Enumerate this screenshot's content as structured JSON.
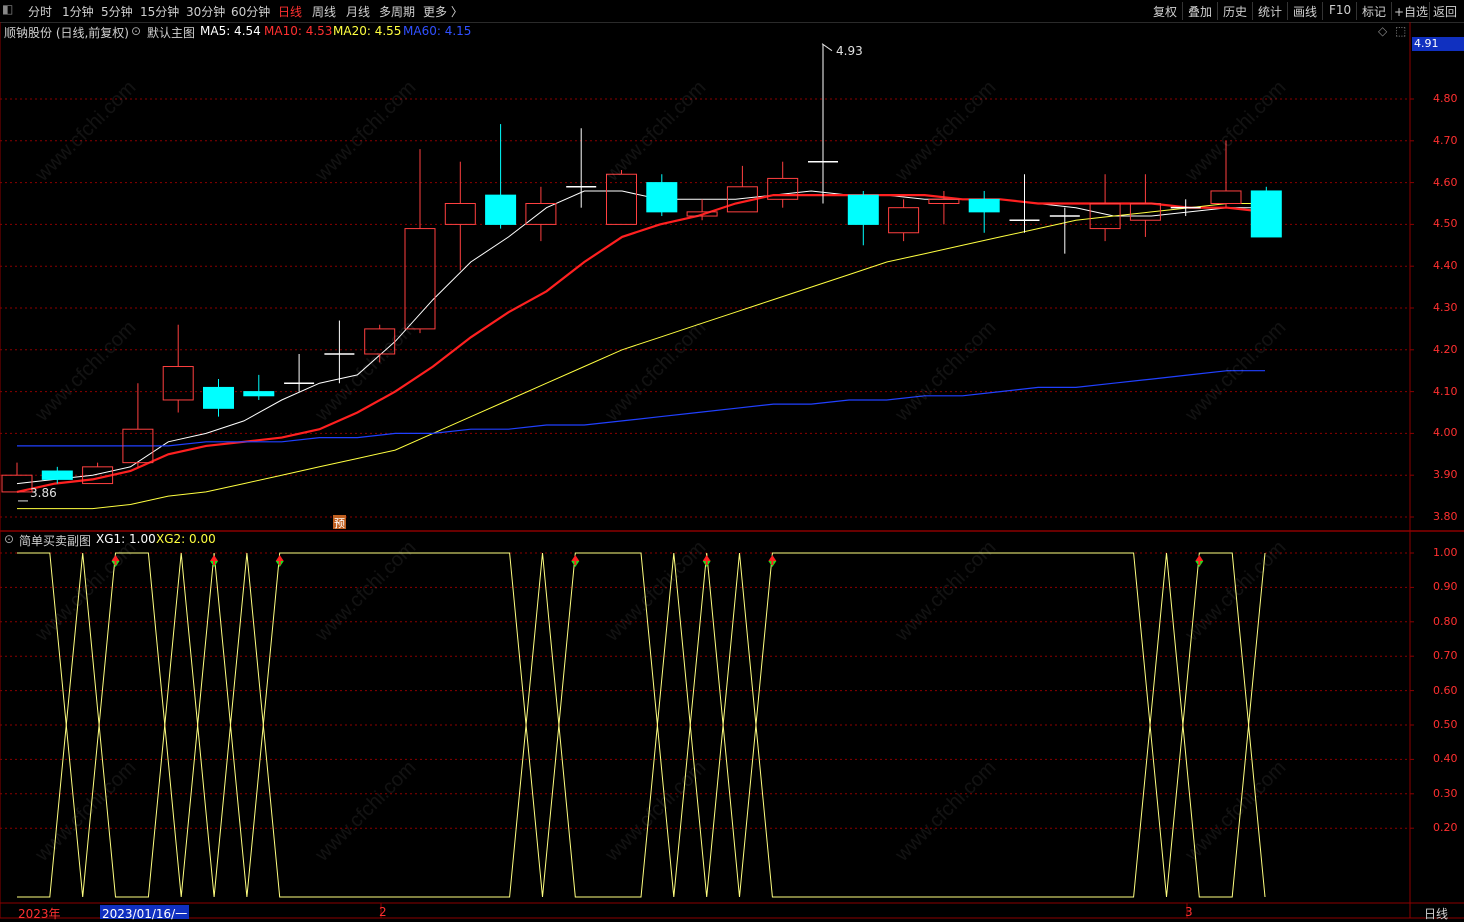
{
  "toolbar": {
    "periods": [
      "分时",
      "1分钟",
      "5分钟",
      "15分钟",
      "30分钟",
      "60分钟",
      "日线",
      "周线",
      "月线",
      "多周期",
      "更多 〉"
    ],
    "active_period": "日线",
    "right_buttons": [
      "复权",
      "叠加",
      "历史",
      "统计",
      "画线",
      "F10",
      "标记",
      "+自选",
      "返回"
    ]
  },
  "main_header": {
    "stock_name": "顺钠股份 (日线,前复权)",
    "chart_name": "默认主图",
    "ma5_label": "MA5: 4.54",
    "ma10_label": "MA10: 4.53",
    "ma20_label": "MA20: 4.55",
    "ma60_label": "MA60: 4.15",
    "current_price_tag": "4.91",
    "high_label": "4.93",
    "low_label": "3.86",
    "marker": "预"
  },
  "sub_header": {
    "indicator_name": "简单买卖副图",
    "xg1_label": "XG1: 1.00",
    "xg2_label": "XG2: 0.00"
  },
  "price_axis": [
    "4.80",
    "4.70",
    "4.60",
    "4.50",
    "4.40",
    "4.30",
    "4.20",
    "4.10",
    "4.00",
    "3.90",
    "3.80"
  ],
  "sub_axis": [
    "1.00",
    "0.90",
    "0.80",
    "0.70",
    "0.60",
    "0.50",
    "0.40",
    "0.30",
    "0.20"
  ],
  "date_axis": {
    "year": "2023年",
    "cursor_date": "2023/01/16/一",
    "month_2": "2",
    "month_3": "3",
    "period_label": "日线"
  },
  "watermark": "www.cfchi.com",
  "colors": {
    "up": "#ff4040",
    "down": "#00ffff",
    "ma5": "#ffffff",
    "ma10": "#ff2020",
    "ma20": "#ffff40",
    "ma60": "#2040ff",
    "signal": "#ffff80",
    "grid": "#8b0000"
  },
  "chart_data": [
    {
      "type": "candlestick",
      "series": [
        {
          "name": "MA5",
          "values": [
            3.88,
            3.89,
            3.9,
            3.92,
            3.98,
            4.0,
            4.03,
            4.08,
            4.12,
            4.14,
            4.22,
            4.32,
            4.41,
            4.47,
            4.54,
            4.58,
            4.58,
            4.56,
            4.56,
            4.56,
            4.57,
            4.58,
            4.57,
            4.57,
            4.56,
            4.56,
            4.56,
            4.55,
            4.54,
            4.52,
            4.52,
            4.53,
            4.54,
            4.54
          ]
        },
        {
          "name": "MA10",
          "values": [
            3.86,
            3.88,
            3.89,
            3.91,
            3.95,
            3.97,
            3.98,
            3.99,
            4.01,
            4.05,
            4.1,
            4.16,
            4.23,
            4.29,
            4.34,
            4.41,
            4.47,
            4.5,
            4.52,
            4.55,
            4.57,
            4.57,
            4.57,
            4.57,
            4.57,
            4.56,
            4.56,
            4.55,
            4.55,
            4.55,
            4.55,
            4.54,
            4.54,
            4.53
          ]
        },
        {
          "name": "MA20",
          "values": [
            3.82,
            3.82,
            3.82,
            3.83,
            3.85,
            3.86,
            3.88,
            3.9,
            3.92,
            3.94,
            3.96,
            4.0,
            4.04,
            4.08,
            4.12,
            4.16,
            4.2,
            4.23,
            4.26,
            4.29,
            4.32,
            4.35,
            4.38,
            4.41,
            4.43,
            4.45,
            4.47,
            4.49,
            4.51,
            4.52,
            4.53,
            4.54,
            4.55,
            4.55
          ]
        },
        {
          "name": "MA60",
          "values": [
            3.97,
            3.97,
            3.97,
            3.97,
            3.97,
            3.98,
            3.98,
            3.98,
            3.99,
            3.99,
            4.0,
            4.0,
            4.01,
            4.01,
            4.02,
            4.02,
            4.03,
            4.04,
            4.05,
            4.06,
            4.07,
            4.07,
            4.08,
            4.08,
            4.09,
            4.09,
            4.1,
            4.11,
            4.11,
            4.12,
            4.13,
            4.14,
            4.15,
            4.15
          ]
        }
      ],
      "candles": [
        {
          "o": 3.86,
          "c": 3.9,
          "h": 3.93,
          "l": 3.86
        },
        {
          "o": 3.91,
          "c": 3.89,
          "h": 3.92,
          "l": 3.88
        },
        {
          "o": 3.88,
          "c": 3.92,
          "h": 3.93,
          "l": 3.88
        },
        {
          "o": 3.93,
          "c": 4.01,
          "h": 4.12,
          "l": 3.92
        },
        {
          "o": 4.08,
          "c": 4.16,
          "h": 4.26,
          "l": 4.05
        },
        {
          "o": 4.11,
          "c": 4.06,
          "h": 4.13,
          "l": 4.04
        },
        {
          "o": 4.1,
          "c": 4.09,
          "h": 4.14,
          "l": 4.08
        },
        {
          "o": 4.12,
          "c": 4.12,
          "h": 4.19,
          "l": 4.1
        },
        {
          "o": 4.19,
          "c": 4.19,
          "h": 4.27,
          "l": 4.12
        },
        {
          "o": 4.19,
          "c": 4.25,
          "h": 4.26,
          "l": 4.17
        },
        {
          "o": 4.25,
          "c": 4.49,
          "h": 4.68,
          "l": 4.24
        },
        {
          "o": 4.5,
          "c": 4.55,
          "h": 4.65,
          "l": 4.39
        },
        {
          "o": 4.57,
          "c": 4.5,
          "h": 4.74,
          "l": 4.49
        },
        {
          "o": 4.5,
          "c": 4.55,
          "h": 4.59,
          "l": 4.46
        },
        {
          "o": 4.59,
          "c": 4.59,
          "h": 4.73,
          "l": 4.54
        },
        {
          "o": 4.5,
          "c": 4.62,
          "h": 4.63,
          "l": 4.5
        },
        {
          "o": 4.6,
          "c": 4.53,
          "h": 4.62,
          "l": 4.52
        },
        {
          "o": 4.52,
          "c": 4.53,
          "h": 4.56,
          "l": 4.51
        },
        {
          "o": 4.53,
          "c": 4.59,
          "h": 4.64,
          "l": 4.53
        },
        {
          "o": 4.56,
          "c": 4.61,
          "h": 4.65,
          "l": 4.54
        },
        {
          "o": 4.65,
          "c": 4.65,
          "h": 4.93,
          "l": 4.55
        },
        {
          "o": 4.57,
          "c": 4.5,
          "h": 4.58,
          "l": 4.45
        },
        {
          "o": 4.48,
          "c": 4.54,
          "h": 4.56,
          "l": 4.46
        },
        {
          "o": 4.55,
          "c": 4.56,
          "h": 4.58,
          "l": 4.5
        },
        {
          "o": 4.56,
          "c": 4.53,
          "h": 4.58,
          "l": 4.48
        },
        {
          "o": 4.51,
          "c": 4.51,
          "h": 4.62,
          "l": 4.48
        },
        {
          "o": 4.52,
          "c": 4.52,
          "h": 4.54,
          "l": 4.43
        },
        {
          "o": 4.49,
          "c": 4.55,
          "h": 4.62,
          "l": 4.46
        },
        {
          "o": 4.51,
          "c": 4.55,
          "h": 4.62,
          "l": 4.47
        },
        {
          "o": 4.54,
          "c": 4.54,
          "h": 4.56,
          "l": 4.52
        },
        {
          "o": 4.55,
          "c": 4.58,
          "h": 4.7,
          "l": 4.54
        },
        {
          "o": 4.58,
          "c": 4.47,
          "h": 4.59,
          "l": 4.47
        }
      ],
      "ylim": [
        3.78,
        4.92
      ]
    },
    {
      "type": "line",
      "series": [
        {
          "name": "XG1",
          "values": [
            1,
            1,
            0,
            1,
            1,
            0,
            1,
            0,
            1,
            1,
            1,
            1,
            1,
            1,
            1,
            1,
            0,
            1,
            1,
            1,
            0,
            1,
            0,
            1,
            1,
            1,
            1,
            1,
            1,
            1,
            1,
            1,
            1,
            1,
            1,
            0,
            1,
            1,
            0
          ]
        },
        {
          "name": "XG2",
          "values": [
            0,
            0,
            1,
            0,
            0,
            1,
            0,
            1,
            0,
            0,
            0,
            0,
            0,
            0,
            0,
            0,
            1,
            0,
            0,
            0,
            1,
            0,
            1,
            0,
            0,
            0,
            0,
            0,
            0,
            0,
            0,
            0,
            0,
            0,
            0,
            1,
            0,
            0,
            1
          ]
        }
      ],
      "ylim": [
        0,
        1
      ]
    }
  ]
}
